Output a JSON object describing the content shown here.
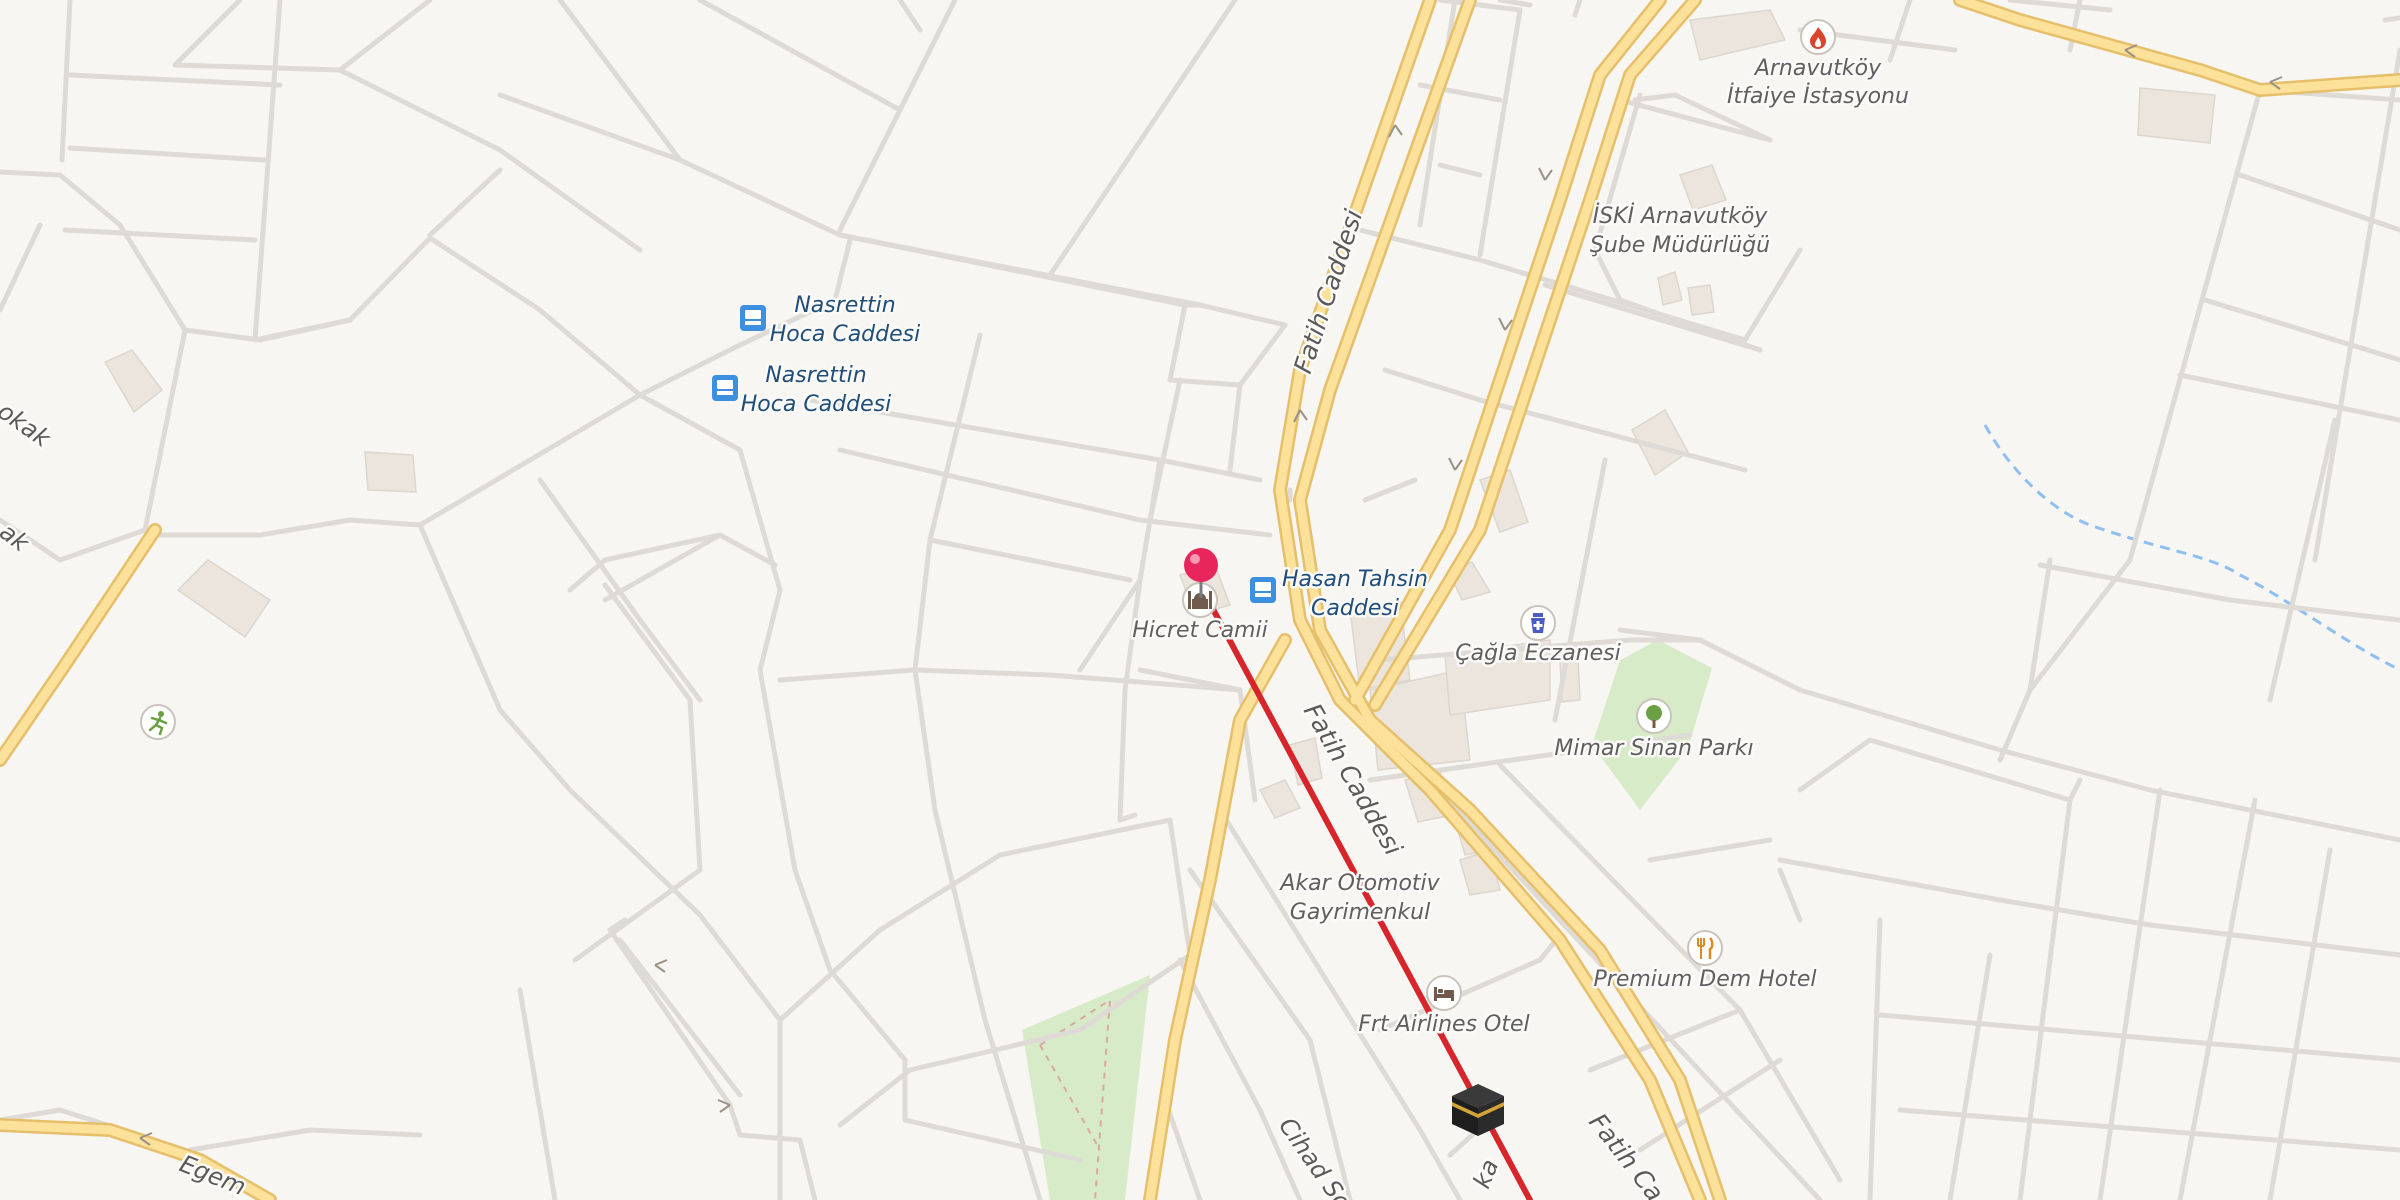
{
  "colors": {
    "background": "#f8f6f3",
    "street": "#dedbd6",
    "arterial_casing": "#e6bf6b",
    "arterial_fill": "#fbe19a",
    "route_line": "#d6262c",
    "pin": "#e8265b",
    "park": "#d8ebc9",
    "building": "#ebe5de",
    "stream": "#8fbef0",
    "bus_stop": "#3d8fe0"
  },
  "pin": {
    "icon": "map-pin-icon"
  },
  "destination": {
    "icon": "kaaba-icon"
  },
  "roads": {
    "fatih_upper": "Fatih Caddesi",
    "fatih_lower": "Fatih Caddesi",
    "fatih_bottom": "Fatih Ca",
    "cihad": "Cihad So",
    "egem": "Egem",
    "sokak_top": "okak",
    "sokak_mid": "ak",
    "bottom_fragment": "ka"
  },
  "bus_stops": [
    {
      "icon": "bus-stop-icon",
      "line1": "Nasrettin",
      "line2": "Hoca Caddesi"
    },
    {
      "icon": "bus-stop-icon",
      "line1": "Nasrettin",
      "line2": "Hoca Caddesi"
    },
    {
      "icon": "bus-stop-icon",
      "line1": "Hasan Tahsin",
      "line2": "Caddesi"
    }
  ],
  "pois": {
    "fire_station": {
      "icon": "fire-station-icon",
      "line1": "Arnavutköy",
      "line2": "İtfaiye İstasyonu"
    },
    "iski": {
      "line1": "İSKİ Arnavutköy",
      "line2": "Şube Müdürlüğü"
    },
    "mosque": {
      "icon": "mosque-icon",
      "label": "Hicret Camii"
    },
    "pharmacy": {
      "icon": "pharmacy-icon",
      "label": "Çağla Eczanesi"
    },
    "park": {
      "icon": "tree-icon",
      "label": "Mimar Sinan Parkı"
    },
    "auto": {
      "line1": "Akar Otomotiv",
      "line2": "Gayrimenkul"
    },
    "restaurant": {
      "icon": "restaurant-icon",
      "label": "Premium Dem Hotel"
    },
    "hotel": {
      "icon": "hotel-bed-icon",
      "label": "Frt Airlines Otel"
    },
    "sport": {
      "icon": "running-figure-icon"
    }
  }
}
